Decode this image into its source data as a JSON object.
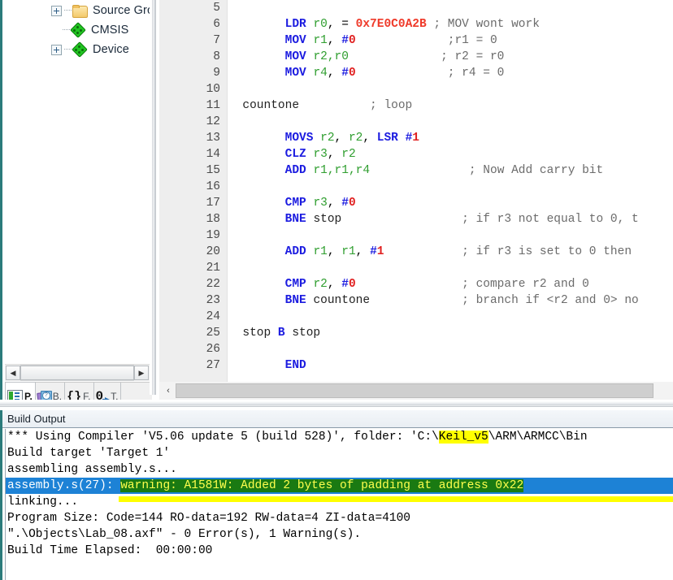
{
  "sidebar": {
    "tree_items": [
      {
        "label": "Source Gro",
        "icon": "folder-icon",
        "expander": true,
        "indent": 60
      },
      {
        "label": "CMSIS",
        "icon": "green-diamond-icon",
        "expander": false,
        "indent": 60
      },
      {
        "label": "Device",
        "icon": "green-diamond-icon",
        "expander": true,
        "indent": 60
      }
    ],
    "scroll_left_arrow": "◀",
    "scroll_right_arrow": "▶",
    "tabs": [
      {
        "label": "P.",
        "icon": "project-icon",
        "active": true
      },
      {
        "label": "B.",
        "icon": "books-icon",
        "active": false
      },
      {
        "label": "F.",
        "icon": "functions-braces-icon",
        "active": false
      },
      {
        "label": "T.",
        "icon": "templates-zero-arrow-icon",
        "active": false
      }
    ]
  },
  "editor": {
    "scroll_left_arrow": "‹",
    "line_numbers": [
      "5",
      "6",
      "7",
      "8",
      "9",
      "10",
      "11",
      "12",
      "13",
      "14",
      "15",
      "16",
      "17",
      "18",
      "19",
      "20",
      "21",
      "22",
      "23",
      "24",
      "25",
      "26",
      "27"
    ],
    "lines": [
      {
        "n": "5",
        "tokens": []
      },
      {
        "n": "6",
        "tokens": [
          {
            "t": "        ",
            "c": "plain"
          },
          {
            "t": "LDR",
            "c": "tok-op"
          },
          {
            "t": " ",
            "c": "plain"
          },
          {
            "t": "r0",
            "c": "tok-reg"
          },
          {
            "t": ", = ",
            "c": "plain"
          },
          {
            "t": "0x7E0C0A2B",
            "c": "tok-num"
          },
          {
            "t": " ; MOV wont work",
            "c": "tok-cmt"
          }
        ]
      },
      {
        "n": "7",
        "tokens": [
          {
            "t": "        ",
            "c": "plain"
          },
          {
            "t": "MOV",
            "c": "tok-op"
          },
          {
            "t": " ",
            "c": "plain"
          },
          {
            "t": "r1",
            "c": "tok-reg"
          },
          {
            "t": ", ",
            "c": "plain"
          },
          {
            "t": "#",
            "c": "tok-hash"
          },
          {
            "t": "0",
            "c": "tok-imm"
          },
          {
            "t": "             ;r1 = 0",
            "c": "tok-cmt"
          }
        ]
      },
      {
        "n": "8",
        "tokens": [
          {
            "t": "        ",
            "c": "plain"
          },
          {
            "t": "MOV",
            "c": "tok-op"
          },
          {
            "t": " ",
            "c": "plain"
          },
          {
            "t": "r2,r0",
            "c": "tok-reg"
          },
          {
            "t": "             ; r2 = r0",
            "c": "tok-cmt"
          }
        ]
      },
      {
        "n": "9",
        "tokens": [
          {
            "t": "        ",
            "c": "plain"
          },
          {
            "t": "MOV",
            "c": "tok-op"
          },
          {
            "t": " ",
            "c": "plain"
          },
          {
            "t": "r4",
            "c": "tok-reg"
          },
          {
            "t": ", ",
            "c": "plain"
          },
          {
            "t": "#",
            "c": "tok-hash"
          },
          {
            "t": "0",
            "c": "tok-imm"
          },
          {
            "t": "             ; r4 = 0",
            "c": "tok-cmt"
          }
        ]
      },
      {
        "n": "10",
        "tokens": []
      },
      {
        "n": "11",
        "tokens": [
          {
            "t": "  ",
            "c": "plain"
          },
          {
            "t": "countone",
            "c": "tok-lbl"
          },
          {
            "t": "          ; loop",
            "c": "tok-cmt"
          }
        ]
      },
      {
        "n": "12",
        "tokens": []
      },
      {
        "n": "13",
        "tokens": [
          {
            "t": "        ",
            "c": "plain"
          },
          {
            "t": "MOVS",
            "c": "tok-op"
          },
          {
            "t": " ",
            "c": "plain"
          },
          {
            "t": "r2",
            "c": "tok-reg"
          },
          {
            "t": ", ",
            "c": "plain"
          },
          {
            "t": "r2",
            "c": "tok-reg"
          },
          {
            "t": ", ",
            "c": "plain"
          },
          {
            "t": "LSR",
            "c": "tok-op"
          },
          {
            "t": " ",
            "c": "plain"
          },
          {
            "t": "#",
            "c": "tok-hash"
          },
          {
            "t": "1",
            "c": "tok-imm"
          }
        ]
      },
      {
        "n": "14",
        "tokens": [
          {
            "t": "        ",
            "c": "plain"
          },
          {
            "t": "CLZ",
            "c": "tok-op"
          },
          {
            "t": " ",
            "c": "plain"
          },
          {
            "t": "r3",
            "c": "tok-reg"
          },
          {
            "t": ", ",
            "c": "plain"
          },
          {
            "t": "r2",
            "c": "tok-reg"
          }
        ]
      },
      {
        "n": "15",
        "tokens": [
          {
            "t": "        ",
            "c": "plain"
          },
          {
            "t": "ADD",
            "c": "tok-op"
          },
          {
            "t": " ",
            "c": "plain"
          },
          {
            "t": "r1,r1,r4",
            "c": "tok-reg"
          },
          {
            "t": "              ; Now Add carry bit",
            "c": "tok-cmt"
          }
        ]
      },
      {
        "n": "16",
        "tokens": []
      },
      {
        "n": "17",
        "tokens": [
          {
            "t": "        ",
            "c": "plain"
          },
          {
            "t": "CMP",
            "c": "tok-op"
          },
          {
            "t": " ",
            "c": "plain"
          },
          {
            "t": "r3",
            "c": "tok-reg"
          },
          {
            "t": ", ",
            "c": "plain"
          },
          {
            "t": "#",
            "c": "tok-hash"
          },
          {
            "t": "0",
            "c": "tok-imm"
          }
        ]
      },
      {
        "n": "18",
        "tokens": [
          {
            "t": "        ",
            "c": "plain"
          },
          {
            "t": "BNE",
            "c": "tok-op"
          },
          {
            "t": " ",
            "c": "plain"
          },
          {
            "t": "stop",
            "c": "tok-lbl"
          },
          {
            "t": "                 ; if r3 not equal to 0, t",
            "c": "tok-cmt"
          }
        ]
      },
      {
        "n": "19",
        "tokens": []
      },
      {
        "n": "20",
        "tokens": [
          {
            "t": "        ",
            "c": "plain"
          },
          {
            "t": "ADD",
            "c": "tok-op"
          },
          {
            "t": " ",
            "c": "plain"
          },
          {
            "t": "r1",
            "c": "tok-reg"
          },
          {
            "t": ", ",
            "c": "plain"
          },
          {
            "t": "r1",
            "c": "tok-reg"
          },
          {
            "t": ", ",
            "c": "plain"
          },
          {
            "t": "#",
            "c": "tok-hash"
          },
          {
            "t": "1",
            "c": "tok-imm"
          },
          {
            "t": "           ; if r3 is set to 0 then",
            "c": "tok-cmt"
          }
        ]
      },
      {
        "n": "21",
        "tokens": []
      },
      {
        "n": "22",
        "tokens": [
          {
            "t": "        ",
            "c": "plain"
          },
          {
            "t": "CMP",
            "c": "tok-op"
          },
          {
            "t": " ",
            "c": "plain"
          },
          {
            "t": "r2",
            "c": "tok-reg"
          },
          {
            "t": ", ",
            "c": "plain"
          },
          {
            "t": "#",
            "c": "tok-hash"
          },
          {
            "t": "0",
            "c": "tok-imm"
          },
          {
            "t": "               ; compare r2 and 0",
            "c": "tok-cmt"
          }
        ]
      },
      {
        "n": "23",
        "tokens": [
          {
            "t": "        ",
            "c": "plain"
          },
          {
            "t": "BNE",
            "c": "tok-op"
          },
          {
            "t": " ",
            "c": "plain"
          },
          {
            "t": "countone",
            "c": "tok-lbl"
          },
          {
            "t": "             ; branch if <r2 and 0> no",
            "c": "tok-cmt"
          }
        ]
      },
      {
        "n": "24",
        "tokens": []
      },
      {
        "n": "25",
        "tokens": [
          {
            "t": "  ",
            "c": "plain"
          },
          {
            "t": "stop",
            "c": "tok-lbl"
          },
          {
            "t": " ",
            "c": "plain"
          },
          {
            "t": "B",
            "c": "tok-op"
          },
          {
            "t": " ",
            "c": "plain"
          },
          {
            "t": "stop",
            "c": "tok-lbl"
          }
        ]
      },
      {
        "n": "26",
        "tokens": []
      },
      {
        "n": "27",
        "tokens": [
          {
            "t": "        ",
            "c": "plain"
          },
          {
            "t": "END",
            "c": "tok-dir"
          }
        ]
      }
    ]
  },
  "build_output": {
    "title": "Build Output",
    "lines": [
      {
        "segments": [
          {
            "t": "*** Using Compiler 'V5.06 update 5 (build 528)', folder: 'C:\\",
            "c": "plain"
          },
          {
            "t": "Keil_v5",
            "c": "hl-yellow"
          },
          {
            "t": "\\ARM\\ARMCC\\Bin",
            "c": "plain"
          }
        ]
      },
      {
        "segments": [
          {
            "t": "Build target 'Target 1'",
            "c": "plain"
          }
        ]
      },
      {
        "segments": [
          {
            "t": "assembling assembly.s...",
            "c": "plain"
          }
        ]
      },
      {
        "selected": true,
        "segments": [
          {
            "t": "assembly.s(27): ",
            "c": "sel-blue"
          },
          {
            "t": "warning: A1581W: Added 2 bytes of padding at address 0x22",
            "c": "sel-green"
          }
        ]
      },
      {
        "segments": [
          {
            "t": "linking...",
            "c": "plain"
          }
        ]
      },
      {
        "segments": [
          {
            "t": "Program Size: Code=144 RO-data=192 RW-data=4 ZI-data=4100",
            "c": "plain"
          }
        ]
      },
      {
        "segments": [
          {
            "t": "\".\\Objects\\Lab_08.axf\" - 0 Error(s), 1 Warning(s).",
            "c": "plain"
          }
        ]
      },
      {
        "segments": [
          {
            "t": "Build Time Elapsed:  00:00:00",
            "c": "plain"
          }
        ]
      }
    ]
  },
  "colors": {
    "accent_teal": "#2b7b7b",
    "selection_blue": "#1d82d6",
    "highlight_yellow": "#ffff00",
    "warning_green": "#1a7a12",
    "opcode_blue": "#1c1ce0",
    "register_green": "#2f9e2f",
    "immediate_red": "#e02020",
    "hex_red": "#ef3a2a",
    "comment_gray": "#6b6b6b"
  }
}
